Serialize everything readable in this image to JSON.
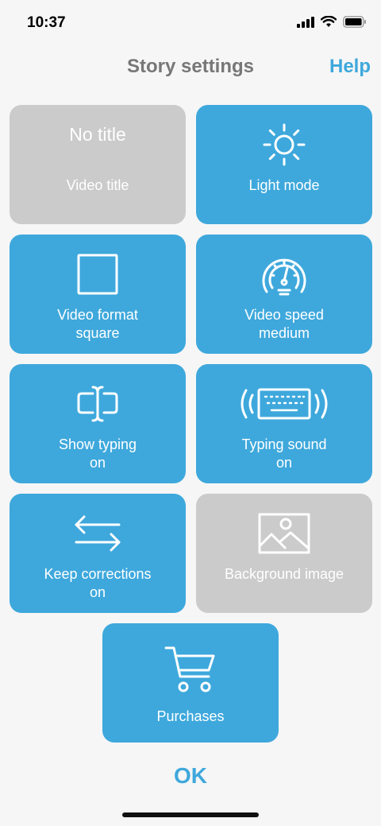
{
  "status_bar": {
    "time": "10:37",
    "icons": [
      "signal-icon",
      "wifi-icon",
      "battery-icon"
    ]
  },
  "header": {
    "title": "Story settings",
    "help_label": "Help"
  },
  "tiles": {
    "video_title": {
      "value": "No title",
      "line1": "Video title",
      "state": "disabled",
      "icon": ""
    },
    "light_mode": {
      "line1": "Light mode",
      "state": "active",
      "icon": "sun-icon"
    },
    "video_format": {
      "line1": "Video format",
      "line2": "square",
      "state": "active",
      "icon": "square-icon"
    },
    "video_speed": {
      "line1": "Video speed",
      "line2": "medium",
      "state": "active",
      "icon": "speedometer-icon"
    },
    "show_typing": {
      "line1": "Show typing",
      "line2": "on",
      "state": "active",
      "icon": "text-cursor-icon"
    },
    "typing_sound": {
      "line1": "Typing sound",
      "line2": "on",
      "state": "active",
      "icon": "keyboard-sound-icon"
    },
    "keep_corrections": {
      "line1": "Keep corrections",
      "line2": "on",
      "state": "active",
      "icon": "swap-arrows-icon"
    },
    "background_image": {
      "line1": "Background image",
      "state": "disabled",
      "icon": "image-icon"
    },
    "purchases": {
      "line1": "Purchases",
      "state": "active",
      "icon": "cart-icon"
    }
  },
  "footer": {
    "ok_label": "OK"
  },
  "colors": {
    "accent": "#3ea8dc",
    "disabled": "#cbcbcb",
    "title_grey": "#777777",
    "background": "#f6f6f6"
  }
}
